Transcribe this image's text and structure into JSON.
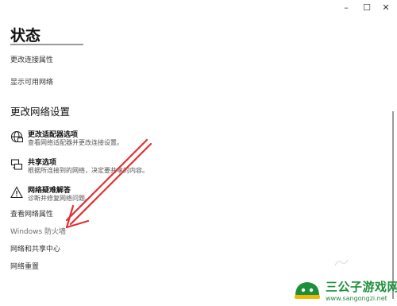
{
  "window": {
    "minimize_glyph": "–",
    "maximize_glyph": "☐",
    "close_glyph": "✕"
  },
  "page": {
    "title": "状态"
  },
  "links_top": [
    "更改连接属性",
    "显示可用网络"
  ],
  "section": {
    "title": "更改网络设置"
  },
  "options": [
    {
      "title": "更改适配器选项",
      "desc": "查看网络适配器并更改连接设置。",
      "icon": "network-adapter-icon"
    },
    {
      "title": "共享选项",
      "desc": "根据所连接到的网络，决定要共享的内容。",
      "icon": "sharing-icon"
    },
    {
      "title": "网络疑难解答",
      "desc": "诊断并修复网络问题。",
      "icon": "warning-icon"
    }
  ],
  "links_bottom": [
    "查看网络属性",
    "Windows 防火墙",
    "网络和共享中心",
    "网络重置"
  ],
  "annotation": {
    "color": "#e03030",
    "shape": "arrow"
  },
  "watermark": {
    "name": "三公子游戏网",
    "url": "www.sangongzi.net",
    "color": "#1d8f3a"
  }
}
